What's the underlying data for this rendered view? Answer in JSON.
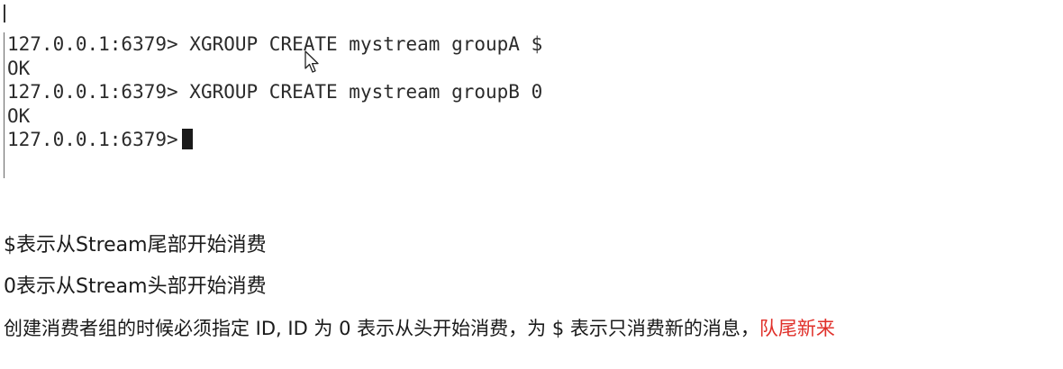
{
  "terminal": {
    "lines": [
      {
        "prompt": "127.0.0.1:6379>",
        "command": " XGROUP CREATE mystream groupA $"
      },
      {
        "output": "OK"
      },
      {
        "prompt": "127.0.0.1:6379>",
        "command": " XGROUP CREATE mystream groupB 0"
      },
      {
        "output": "OK"
      },
      {
        "prompt": "127.0.0.1:6379>",
        "command": " "
      }
    ]
  },
  "notes": {
    "line1": "$表示从Stream尾部开始消费",
    "line2": "0表示从Stream头部开始消费",
    "line3_main": "创建消费者组的时候必须指定 ID, ID 为 0 表示从头开始消费，为 $ 表示只消费新的消息，",
    "line3_highlight": "队尾新来"
  },
  "colors": {
    "highlight": "#e0302a"
  }
}
